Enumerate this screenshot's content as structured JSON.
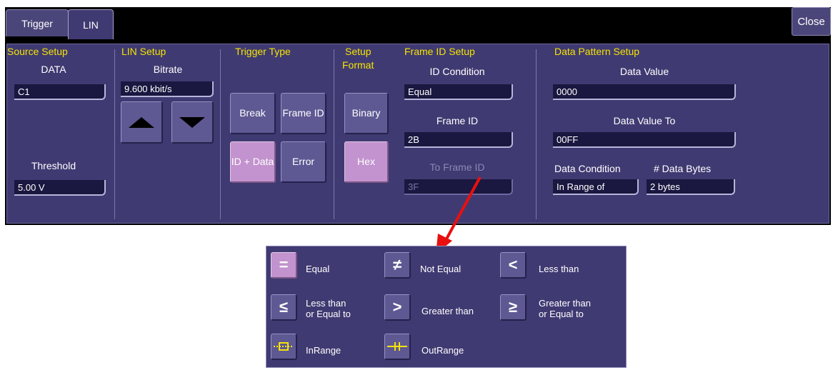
{
  "tabs": [
    "Trigger",
    "LIN"
  ],
  "close_label": "Close",
  "source_setup": {
    "title": "Source Setup",
    "data_label": "DATA",
    "data_value": "C1",
    "threshold_label": "Threshold",
    "threshold_value": "5.00 V"
  },
  "lin_setup": {
    "title": "LIN Setup",
    "bitrate_label": "Bitrate",
    "bitrate_value": "9.600 kbit/s"
  },
  "trigger_type": {
    "title": "Trigger Type",
    "buttons": [
      "Break",
      "Frame ID",
      "ID + Data",
      "Error"
    ],
    "selected": "ID + Data"
  },
  "setup_format": {
    "title_line1": "Setup",
    "title_line2": "Format",
    "buttons": [
      "Binary",
      "Hex"
    ],
    "selected": "Hex"
  },
  "frame_id_setup": {
    "title": "Frame ID Setup",
    "id_condition_label": "ID Condition",
    "id_condition_value": "Equal",
    "frame_id_label": "Frame ID",
    "frame_id_value": "2B",
    "to_frame_id_label": "To Frame ID",
    "to_frame_id_value": "3F"
  },
  "data_pattern_setup": {
    "title": "Data Pattern Setup",
    "data_value_label": "Data Value",
    "data_value": "0000",
    "data_value_to_label": "Data Value To",
    "data_value_to": "00FF",
    "data_condition_label": "Data Condition",
    "data_condition_value": "In Range of",
    "data_bytes_label": "# Data Bytes",
    "data_bytes_value": "2 bytes"
  },
  "condition_popup": {
    "items": [
      {
        "label": "Equal",
        "icon": "equal-icon",
        "selected": true
      },
      {
        "label": "Not Equal",
        "icon": "not-equal-icon",
        "selected": false
      },
      {
        "label": "Less than",
        "icon": "less-than-icon",
        "selected": false
      },
      {
        "label": "Less than\nor Equal to",
        "icon": "less-equal-icon",
        "selected": false
      },
      {
        "label": "Greater than",
        "icon": "greater-than-icon",
        "selected": false
      },
      {
        "label": "Greater than\nor Equal to",
        "icon": "greater-equal-icon",
        "selected": false
      },
      {
        "label": "InRange",
        "icon": "in-range-icon",
        "selected": false
      },
      {
        "label": "OutRange",
        "icon": "out-range-icon",
        "selected": false
      }
    ]
  },
  "colors": {
    "panel_bg": "#403a72",
    "title_text": "#f5e400",
    "selected_button": "#c293ce",
    "button": "#5e5893",
    "arrow": "#e8100e"
  }
}
